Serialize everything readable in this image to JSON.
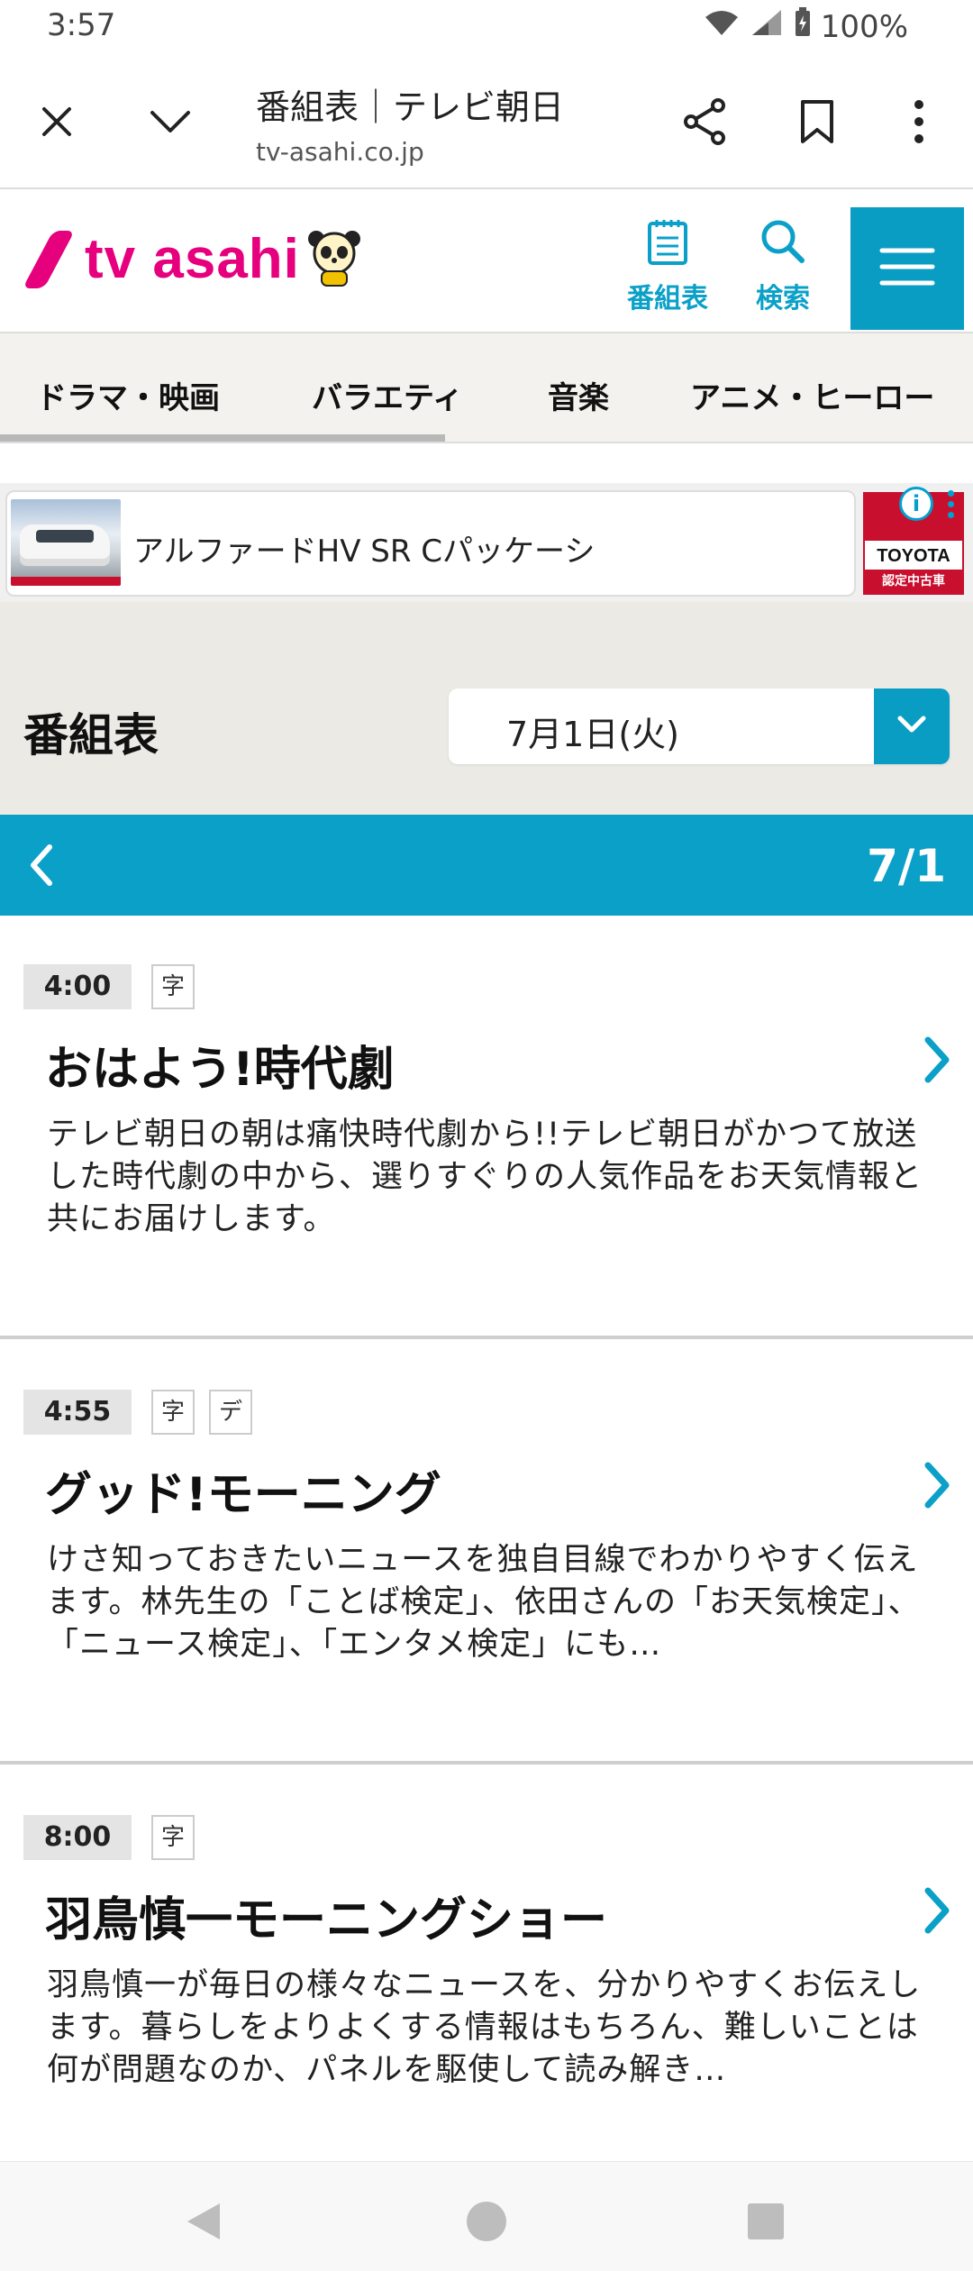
{
  "status_bar": {
    "time": "3:57",
    "battery": "100%"
  },
  "browser": {
    "page_title": "番組表｜テレビ朝日",
    "url": "tv-asahi.co.jp"
  },
  "site_header": {
    "logo_text": "tv asahi",
    "schedule_label": "番組表",
    "search_label": "検索",
    "accent_color": "#0aa0c8",
    "brand_color": "#e6007e"
  },
  "category_nav": {
    "items": [
      "ドラマ・映画",
      "バラエティ",
      "音楽",
      "アニメ・ヒーロー"
    ]
  },
  "ad": {
    "text": "アルファードHV SR Cパッケーシ",
    "logo_brand": "TOYOTA",
    "logo_sub": "認定中古車"
  },
  "schedule": {
    "title": "番組表",
    "selected_date": "7月1日(火)",
    "day_label": "7/1"
  },
  "programs": [
    {
      "time": "4:00",
      "tags": [
        "字"
      ],
      "title": "おはよう!時代劇",
      "description": "テレビ朝日の朝は痛快時代劇から!!テレビ朝日がかつて放送した時代劇の中から、選りすぐりの人気作品をお天気情報と共にお届けします。"
    },
    {
      "time": "4:55",
      "tags": [
        "字",
        "デ"
      ],
      "title": "グッド!モーニング",
      "description": "けさ知っておきたいニュースを独自目線でわかりやすく伝えます。林先生の「ことば検定」、依田さんの「お天気検定」、「ニュース検定」、「エンタメ検定」にも…"
    },
    {
      "time": "8:00",
      "tags": [
        "字"
      ],
      "title": "羽鳥慎一モーニングショー",
      "description": "羽鳥慎一が毎日の様々なニュースを、分かりやすくお伝えします。暮らしをよりよくする情報はもちろん、難しいことは何が問題なのか、パネルを駆使して読み解き…"
    }
  ]
}
